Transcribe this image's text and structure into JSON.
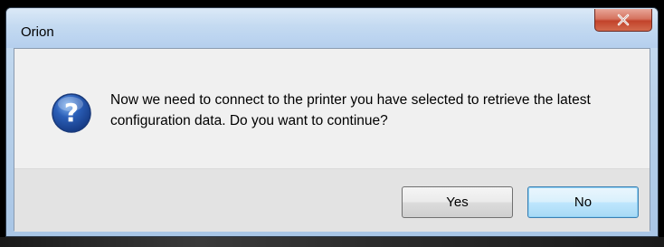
{
  "window": {
    "title": "Orion",
    "close_icon": "close-icon"
  },
  "dialog": {
    "icon": "question-icon",
    "message": "Now we need to connect to the printer you have selected to retrieve the latest configuration data.  Do you want to continue?"
  },
  "buttons": {
    "yes_label": "Yes",
    "no_label": "No"
  },
  "colors": {
    "titlebar": "#c4daf1",
    "close_button": "#c2432b",
    "client_background": "#f0f0f0",
    "button_area": "#e3e3e3",
    "default_button_border": "#3c7fb1",
    "question_icon": "#2b5fb8"
  }
}
